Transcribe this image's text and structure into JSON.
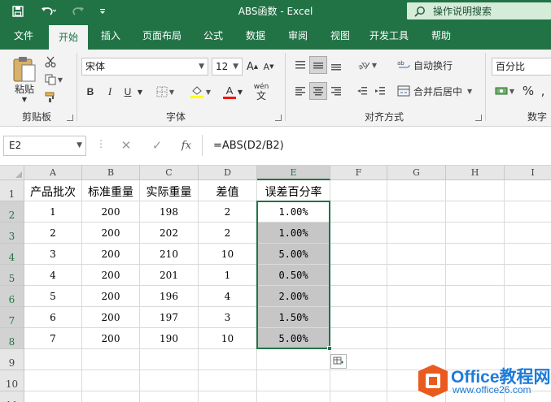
{
  "window": {
    "title": "ABS函数  -  Excel",
    "help_search": "操作说明搜索"
  },
  "quick_access": [
    "save-icon",
    "undo-icon",
    "redo-icon",
    "customize-icon"
  ],
  "ribbon_tabs": [
    {
      "label": "文件",
      "active": false
    },
    {
      "label": "开始",
      "active": true
    },
    {
      "label": "插入",
      "active": false
    },
    {
      "label": "页面布局",
      "active": false
    },
    {
      "label": "公式",
      "active": false
    },
    {
      "label": "数据",
      "active": false
    },
    {
      "label": "审阅",
      "active": false
    },
    {
      "label": "视图",
      "active": false
    },
    {
      "label": "开发工具",
      "active": false
    },
    {
      "label": "帮助",
      "active": false
    }
  ],
  "ribbon": {
    "clipboard": {
      "paste_label": "粘贴",
      "group_label": "剪贴板"
    },
    "font": {
      "name": "宋体",
      "size": "12",
      "bold": "B",
      "italic": "I",
      "underline": "U",
      "phonetic": "wén",
      "grow": "A",
      "shrink": "A",
      "font_color": "A",
      "group_label": "字体"
    },
    "alignment": {
      "wrap_text": "自动换行",
      "merge_center": "合并后居中",
      "group_label": "对齐方式"
    },
    "number": {
      "format": "百分比",
      "percent": "%",
      "group_label": "数字"
    }
  },
  "formula_bar": {
    "name_box": "E2",
    "fx": "fx",
    "formula": "=ABS(D2/B2)"
  },
  "columns": [
    "A",
    "B",
    "C",
    "D",
    "E",
    "F",
    "G",
    "H",
    "I"
  ],
  "rows": [
    "1",
    "2",
    "3",
    "4",
    "5",
    "6",
    "7",
    "8",
    "9",
    "10",
    "11"
  ],
  "table": {
    "headers": [
      "产品批次",
      "标准重量",
      "实际重量",
      "差值",
      "误差百分率"
    ],
    "rows": [
      [
        "1",
        "200",
        "198",
        "2",
        "1.00%"
      ],
      [
        "2",
        "200",
        "202",
        "2",
        "1.00%"
      ],
      [
        "3",
        "200",
        "210",
        "10",
        "5.00%"
      ],
      [
        "4",
        "200",
        "201",
        "1",
        "0.50%"
      ],
      [
        "5",
        "200",
        "196",
        "4",
        "2.00%"
      ],
      [
        "6",
        "200",
        "197",
        "3",
        "1.50%"
      ],
      [
        "7",
        "200",
        "190",
        "10",
        "5.00%"
      ]
    ]
  },
  "watermark": {
    "line1": "Office教程网",
    "line2": "www.office26.com"
  },
  "colors": {
    "excel_green": "#217346",
    "selection_fill": "#c6c6c6",
    "watermark_orange": "#ea5a1e",
    "watermark_blue": "#1e7bd8"
  }
}
